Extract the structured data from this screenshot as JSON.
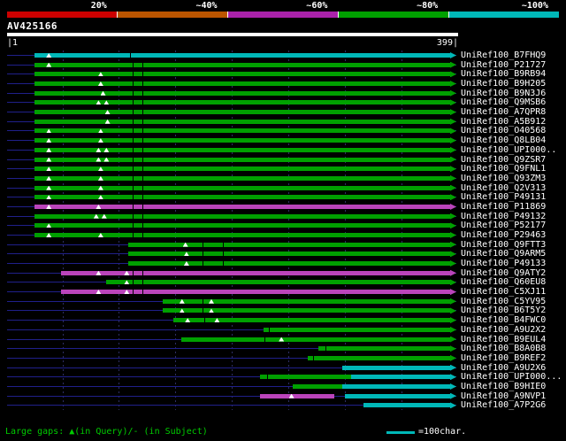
{
  "chart_data": {
    "type": "bar",
    "title": "AV425166",
    "x_range": [
      1,
      399
    ],
    "x_axis_ticks": [
      "|1",
      "399|"
    ],
    "grid_x": [
      50,
      100,
      150,
      200,
      250,
      300,
      350
    ],
    "identity_key": {
      "labels": [
        "20%",
        "~40%",
        "~60%",
        "~80%",
        "~100%"
      ],
      "colors": [
        "#cc0000",
        "#bb5500",
        "#aa22aa",
        "#00a000",
        "#00b8b8"
      ]
    },
    "bar_colors": {
      "green": "#00a000",
      "magenta": "#bb44bb",
      "cyan": "#00b8b8"
    },
    "query": {
      "label": "AV425166",
      "from": 1,
      "to": 399,
      "color": "#ffffff"
    },
    "rows": [
      {
        "label": "UniRef100_B7FHQ9",
        "segments": [
          {
            "from": 25,
            "to": 399,
            "color": "cyan"
          }
        ],
        "triangles": [
          38
        ],
        "ticks": [
          110
        ]
      },
      {
        "label": "UniRef100_P21727",
        "segments": [
          {
            "from": 25,
            "to": 399,
            "color": "green"
          }
        ],
        "triangles": [
          38
        ],
        "ticks": [
          112,
          121
        ]
      },
      {
        "label": "UniRef100_B9RB94",
        "segments": [
          {
            "from": 25,
            "to": 399,
            "color": "green"
          }
        ],
        "triangles": [
          84
        ],
        "ticks": [
          112,
          121
        ]
      },
      {
        "label": "UniRef100_B9H205",
        "segments": [
          {
            "from": 25,
            "to": 399,
            "color": "green"
          }
        ],
        "triangles": [
          84
        ],
        "ticks": [
          112,
          121
        ]
      },
      {
        "label": "UniRef100_B9N3J6",
        "segments": [
          {
            "from": 25,
            "to": 399,
            "color": "green"
          }
        ],
        "triangles": [
          86
        ],
        "ticks": [
          112,
          121
        ]
      },
      {
        "label": "UniRef100_Q9MSB6",
        "segments": [
          {
            "from": 25,
            "to": 399,
            "color": "green"
          }
        ],
        "triangles": [
          82,
          89
        ],
        "ticks": [
          112,
          121
        ]
      },
      {
        "label": "UniRef100_A7QPR8",
        "segments": [
          {
            "from": 25,
            "to": 399,
            "color": "green"
          }
        ],
        "triangles": [
          90
        ],
        "ticks": [
          112,
          121
        ]
      },
      {
        "label": "UniRef100_A5B912",
        "segments": [
          {
            "from": 25,
            "to": 399,
            "color": "green"
          }
        ],
        "triangles": [
          90
        ],
        "ticks": [
          112,
          121
        ]
      },
      {
        "label": "UniRef100_O40568",
        "segments": [
          {
            "from": 25,
            "to": 399,
            "color": "green"
          }
        ],
        "triangles": [
          38,
          84
        ],
        "ticks": [
          112,
          121
        ]
      },
      {
        "label": "UniRef100_Q8LB04",
        "segments": [
          {
            "from": 25,
            "to": 399,
            "color": "green"
          }
        ],
        "triangles": [
          38,
          84
        ],
        "ticks": [
          112,
          121
        ]
      },
      {
        "label": "UniRef100_UPI000..",
        "segments": [
          {
            "from": 25,
            "to": 399,
            "color": "green"
          }
        ],
        "triangles": [
          38,
          82,
          89
        ],
        "ticks": [
          112,
          121
        ]
      },
      {
        "label": "UniRef100_Q9ZSR7",
        "segments": [
          {
            "from": 25,
            "to": 399,
            "color": "green"
          }
        ],
        "triangles": [
          38,
          82,
          89
        ],
        "ticks": [
          112,
          121
        ]
      },
      {
        "label": "UniRef100_Q9FNL1",
        "segments": [
          {
            "from": 25,
            "to": 399,
            "color": "green"
          }
        ],
        "triangles": [
          38,
          84
        ],
        "ticks": [
          112,
          121
        ]
      },
      {
        "label": "UniRef100_Q93ZM3",
        "segments": [
          {
            "from": 25,
            "to": 399,
            "color": "green"
          }
        ],
        "triangles": [
          38,
          84
        ],
        "ticks": [
          112,
          121
        ]
      },
      {
        "label": "UniRef100_Q2V313",
        "segments": [
          {
            "from": 25,
            "to": 399,
            "color": "green"
          }
        ],
        "triangles": [
          38,
          84
        ],
        "ticks": [
          112,
          121
        ]
      },
      {
        "label": "UniRef100_P49131",
        "segments": [
          {
            "from": 25,
            "to": 399,
            "color": "green"
          }
        ],
        "triangles": [
          38,
          84
        ],
        "ticks": [
          112,
          121
        ]
      },
      {
        "label": "UniRef100_P11869",
        "segments": [
          {
            "from": 25,
            "to": 399,
            "color": "magenta"
          }
        ],
        "triangles": [
          38,
          82
        ],
        "ticks": [
          112,
          121
        ]
      },
      {
        "label": "UniRef100_P49132",
        "segments": [
          {
            "from": 25,
            "to": 399,
            "color": "green"
          }
        ],
        "triangles": [
          80,
          87
        ],
        "ticks": [
          112,
          121
        ]
      },
      {
        "label": "UniRef100_P52177",
        "segments": [
          {
            "from": 25,
            "to": 399,
            "color": "green"
          }
        ],
        "triangles": [
          38
        ],
        "ticks": [
          112,
          121
        ]
      },
      {
        "label": "UniRef100_P29463",
        "segments": [
          {
            "from": 25,
            "to": 399,
            "color": "green"
          }
        ],
        "triangles": [
          38,
          84
        ],
        "ticks": [
          112,
          121
        ]
      },
      {
        "label": "UniRef100_Q9FTT3",
        "segments": [
          {
            "from": 108,
            "to": 399,
            "color": "green"
          }
        ],
        "triangles": [
          159
        ],
        "ticks": [
          174,
          192
        ]
      },
      {
        "label": "UniRef100_Q9ARM5",
        "segments": [
          {
            "from": 108,
            "to": 399,
            "color": "green"
          }
        ],
        "triangles": [
          160
        ],
        "ticks": [
          174,
          192
        ]
      },
      {
        "label": "UniRef100_P49133",
        "segments": [
          {
            "from": 108,
            "to": 399,
            "color": "green"
          }
        ],
        "triangles": [
          160
        ],
        "ticks": [
          174,
          192
        ]
      },
      {
        "label": "UniRef100_Q9ATY2",
        "segments": [
          {
            "from": 49,
            "to": 399,
            "color": "magenta"
          }
        ],
        "triangles": [
          82,
          107
        ],
        "ticks": [
          112,
          121
        ]
      },
      {
        "label": "UniRef100_Q60EU8",
        "segments": [
          {
            "from": 89,
            "to": 399,
            "color": "green"
          }
        ],
        "triangles": [
          107
        ],
        "ticks": [
          112,
          121
        ]
      },
      {
        "label": "UniRef100_C5XJ11",
        "segments": [
          {
            "from": 49,
            "to": 399,
            "color": "magenta"
          }
        ],
        "triangles": [
          82,
          107
        ],
        "ticks": [
          112,
          121
        ]
      },
      {
        "label": "UniRef100_C5YV95",
        "segments": [
          {
            "from": 139,
            "to": 399,
            "color": "green"
          }
        ],
        "triangles": [
          156,
          182
        ],
        "ticks": [
          174
        ]
      },
      {
        "label": "UniRef100_B6T5Y2",
        "segments": [
          {
            "from": 139,
            "to": 399,
            "color": "green"
          }
        ],
        "triangles": [
          156,
          182
        ],
        "ticks": [
          174
        ]
      },
      {
        "label": "UniRef100_B4FWC0",
        "segments": [
          {
            "from": 148,
            "to": 399,
            "color": "green"
          }
        ],
        "triangles": [
          161,
          187
        ],
        "ticks": [
          176
        ]
      },
      {
        "label": "UniRef100_A9U2X2",
        "segments": [
          {
            "from": 228,
            "to": 399,
            "color": "green"
          }
        ],
        "triangles": [],
        "ticks": [
          233
        ]
      },
      {
        "label": "UniRef100_B9EUL4",
        "segments": [
          {
            "from": 155,
            "to": 399,
            "color": "green"
          }
        ],
        "triangles": [
          244
        ],
        "ticks": [
          229
        ]
      },
      {
        "label": "UniRef100_B8A0B8",
        "segments": [
          {
            "from": 277,
            "to": 399,
            "color": "green"
          }
        ],
        "triangles": [],
        "ticks": [
          283
        ]
      },
      {
        "label": "UniRef100_B9REF2",
        "segments": [
          {
            "from": 267,
            "to": 399,
            "color": "green"
          }
        ],
        "triangles": [],
        "ticks": [
          272
        ]
      },
      {
        "label": "UniRef100_A9U2X6",
        "segments": [
          {
            "from": 298,
            "to": 399,
            "color": "cyan"
          }
        ],
        "triangles": [],
        "ticks": []
      },
      {
        "label": "UniRef100_UPI000...",
        "segments": [
          {
            "from": 225,
            "to": 306,
            "color": "green"
          },
          {
            "from": 306,
            "to": 399,
            "color": "cyan"
          }
        ],
        "triangles": [],
        "ticks": [
          231
        ]
      },
      {
        "label": "UniRef100_B9HIE0",
        "segments": [
          {
            "from": 254,
            "to": 298,
            "color": "green"
          },
          {
            "from": 298,
            "to": 399,
            "color": "cyan"
          }
        ],
        "triangles": [],
        "ticks": []
      },
      {
        "label": "UniRef100_A9NVP1",
        "segments": [
          {
            "from": 225,
            "to": 291,
            "color": "magenta"
          },
          {
            "from": 300,
            "to": 399,
            "color": "cyan"
          }
        ],
        "triangles": [
          253
        ],
        "ticks": []
      },
      {
        "label": "UniRef100_A7P2G6",
        "segments": [
          {
            "from": 317,
            "to": 399,
            "color": "cyan"
          }
        ],
        "triangles": [],
        "ticks": []
      }
    ]
  },
  "query": {
    "title": "AV425166",
    "scale_left": "|1",
    "scale_right": "399|"
  },
  "footer": {
    "gaps_text": "Large gaps: ▲(in Query)/- (in Subject)",
    "scale_legend_text": "=100char.",
    "scale_legend_color": "#00b8b8"
  }
}
